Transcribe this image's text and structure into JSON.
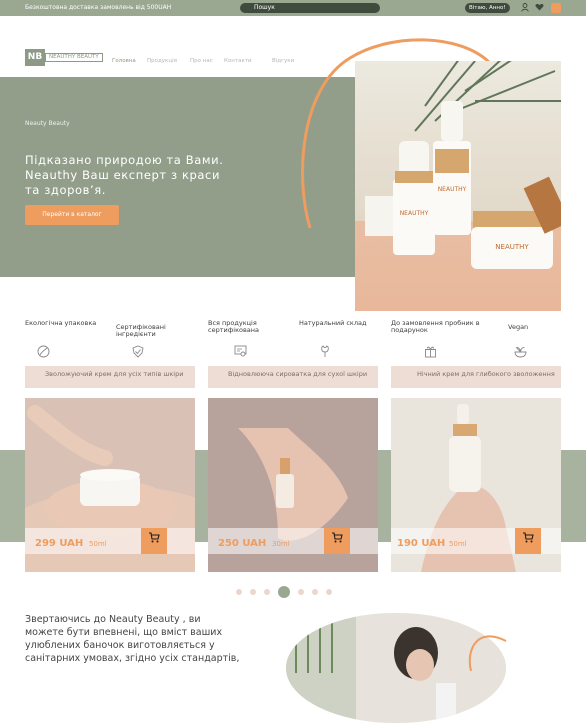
{
  "topbar": {
    "shipping": "Безкоштовна доставка замовлень від 500UAH",
    "search_label": "Пошук",
    "greeting": "Вітаю, Анно!"
  },
  "nav": {
    "logo_mark": "NB",
    "logo_name": "NEAUTHY BEAUTY",
    "links": [
      "Головна",
      "Продукція",
      "Про нас",
      "Контакти",
      "Відгуки"
    ]
  },
  "hero": {
    "brand": "Neauty Beauty",
    "headline": "Підказано природою та Вами. Neauthy Ваш експерт з краси та здоров’я.",
    "cta": "Перейти в каталог",
    "product_label": "NEAUTHY"
  },
  "features": [
    {
      "label": "Екологічна упаковка",
      "icon": "eco-globe-icon"
    },
    {
      "label": "Сертифіковані інгредієнти",
      "icon": "shield-check-icon"
    },
    {
      "label": "Вся продукція сертифікована",
      "icon": "certificate-icon"
    },
    {
      "label": "Натуральний склад",
      "icon": "flower-icon"
    },
    {
      "label": "До замовлення пробник в подарунок",
      "icon": "gift-icon"
    },
    {
      "label": "Vegan",
      "icon": "vegan-bowl-icon"
    }
  ],
  "products": [
    {
      "title": "Зволожуючий крем для усіх типів шкіри",
      "price": "299 UAH",
      "volume": "50ml"
    },
    {
      "title": "Відновлююча сироватка для сухої шкіри",
      "price": "250 UAH",
      "volume": "30ml"
    },
    {
      "title": "Нічний крем для глибокого зволоження",
      "price": "190 UAH",
      "volume": "50ml"
    }
  ],
  "carousel": {
    "count": 7,
    "active": 3
  },
  "about": {
    "text": "Звертаючись до Neauty Beauty , ви можете бути впевнені, що вміст ваших улюблених баночок виготовляється у санітарних умовах, згідно усіх стандартів,"
  },
  "colors": {
    "sage": "#939e8a",
    "accent": "#ef9c5f",
    "blush": "#eeddd5"
  }
}
